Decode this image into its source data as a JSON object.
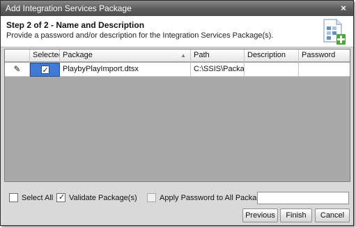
{
  "window": {
    "title": "Add Integration Services Package",
    "close_glyph": "×"
  },
  "header": {
    "step": "Step 2 of 2 - Name and Description",
    "description": "Provide a password and/or description for the Integration Services Package(s).",
    "icon": "package-add-icon"
  },
  "grid": {
    "columns": [
      "Selected",
      "Package",
      "Path",
      "Description",
      "Password"
    ],
    "rows": [
      {
        "edit_glyph": "✎",
        "selected": "✓",
        "package": "PlaybyPlayImport.dtsx",
        "path": "C:\\SSIS\\Packa...",
        "description": "",
        "password": ""
      }
    ]
  },
  "options": {
    "select_all": "Select All",
    "validate": "Validate Package(s)",
    "validate_check": "✓",
    "apply_password": "Apply Password to All Packages:",
    "password_value": ""
  },
  "buttons": {
    "previous": "Previous",
    "finish": "Finish",
    "cancel": "Cancel"
  },
  "colors": {
    "title_bar": "#5f5f5f",
    "selection": "#3f7bd6",
    "grid_background": "#a9a9a9",
    "icon_plus": "#3fae2a"
  }
}
